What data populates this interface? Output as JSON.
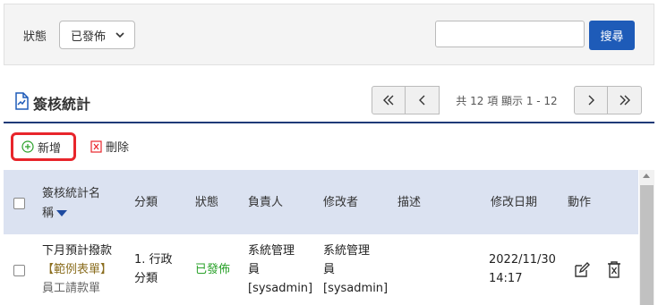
{
  "filter": {
    "status_label": "狀態",
    "status_value": "已發佈",
    "search_value": "",
    "search_placeholder": "",
    "search_button": "搜尋"
  },
  "page": {
    "title": "簽核統計"
  },
  "pager": {
    "info": "共 12 項 顯示 1 - 12"
  },
  "toolbar": {
    "add_label": "新增",
    "delete_label": "刪除"
  },
  "table": {
    "headers": {
      "name_line1": "簽核統計名",
      "name_line2": "稱",
      "category": "分類",
      "status": "狀態",
      "owner": "負責人",
      "modifier": "修改者",
      "description": "描述",
      "modified_date": "修改日期",
      "actions": "動作"
    },
    "rows": [
      {
        "name": "下月預計撥款",
        "tag": "【範例表單】",
        "form": "員工請款單",
        "category_line1": "1. 行政",
        "category_line2": "分類",
        "status": "已發佈",
        "owner_line1": "系統管理",
        "owner_line2": "員",
        "owner_line3": "[sysadmin]",
        "modifier_line1": "系統管理",
        "modifier_line2": "員",
        "modifier_line3": "[sysadmin]",
        "description": "",
        "date_line1": "2022/11/30",
        "date_line2": "14:17"
      }
    ]
  },
  "colors": {
    "primary": "#1e5bb8",
    "title_underline": "#1e3a78",
    "highlight": "#e8252b",
    "published": "#2aa12a",
    "header_bg": "#dbe2f1"
  }
}
